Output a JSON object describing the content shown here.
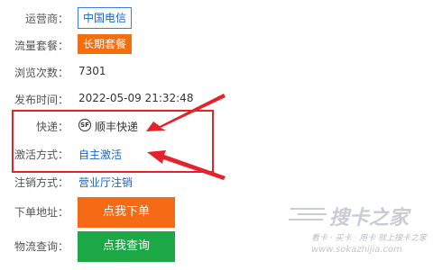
{
  "fields": {
    "operator": {
      "label": "运营商：",
      "value": "中国电信"
    },
    "plan": {
      "label": "流量套餐：",
      "value": "长期套餐"
    },
    "views": {
      "label": "浏览次数：",
      "value": "7301"
    },
    "published": {
      "label": "发布时间：",
      "value": "2022-05-09 21:32:48"
    },
    "courier": {
      "label": "快递：",
      "icon": "sf-express-icon",
      "icon_text": "SF",
      "value": "顺丰快递"
    },
    "activation": {
      "label": "激活方式：",
      "value": "自主激活"
    },
    "cancel": {
      "label": "注销方式：",
      "value": "营业厅注销"
    },
    "order": {
      "label": "下单地址：",
      "button": "点我下单"
    },
    "logistics": {
      "label": "物流查询：",
      "button": "点我查询"
    }
  },
  "watermark": {
    "brand": "搜卡之家",
    "slogan": "看卡 · 买卡 · 用卡 就上搜卡之家",
    "url": "www.sokazhijia.com"
  },
  "colors": {
    "accent_blue": "#1a64c8",
    "orange": "#f56a14",
    "green": "#1ca844",
    "highlight_red": "#e4222c"
  }
}
